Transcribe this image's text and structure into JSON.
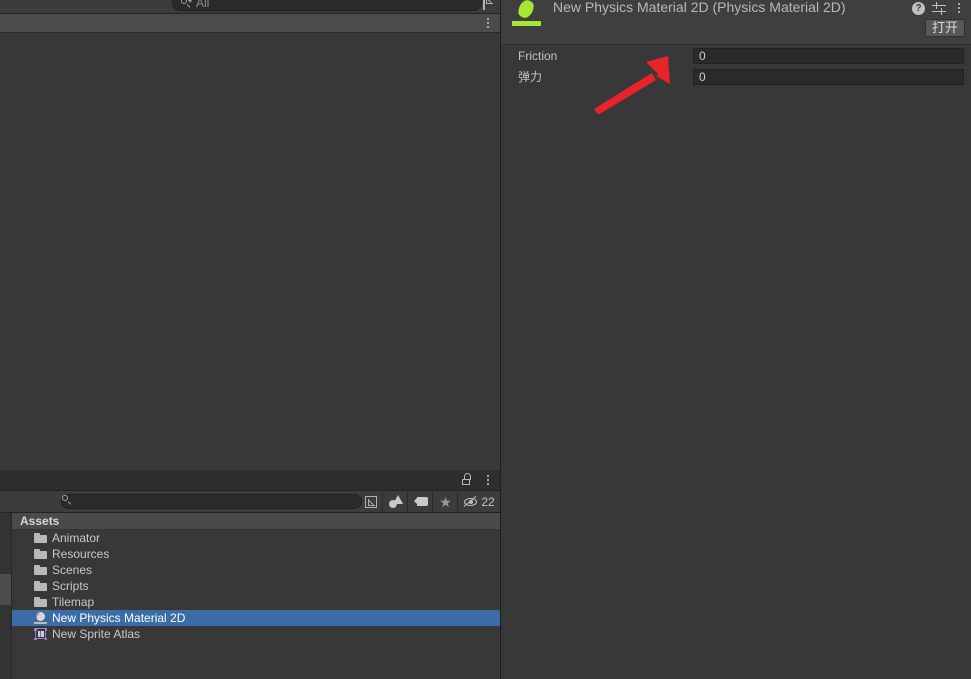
{
  "window": {
    "background_color": "#383838",
    "accent_selection_color": "#3a6da8",
    "asset_icon_green": "#a6e635",
    "annotation_color": "#e8232a"
  },
  "top_bar": {
    "search_placeholder": "All",
    "search_icon": "search-icon",
    "expand_icon": "expand-search-icon",
    "overflow_icon": "kebab-menu-icon"
  },
  "project_panel": {
    "lock_icon": "lock-icon",
    "overflow_icon": "kebab-menu-icon",
    "search_value": "",
    "search_icon": "search-icon",
    "expand_icon": "expand-search-icon",
    "filters": [
      {
        "name": "type-filter",
        "icon": "object-type-icon"
      },
      {
        "name": "label-filter",
        "icon": "tag-icon"
      },
      {
        "name": "favorites-filter",
        "icon": "star-icon",
        "glyph": "★"
      },
      {
        "name": "hidden-filter",
        "icon": "eye-off-icon",
        "count": "22"
      }
    ],
    "breadcrumb": "Assets",
    "items": [
      {
        "label": "Animator",
        "icon": "folder-icon",
        "selected": false
      },
      {
        "label": "Resources",
        "icon": "folder-icon",
        "selected": false
      },
      {
        "label": "Scenes",
        "icon": "folder-icon",
        "selected": false
      },
      {
        "label": "Scripts",
        "icon": "folder-icon",
        "selected": false
      },
      {
        "label": "Tilemap",
        "icon": "folder-icon",
        "selected": false
      },
      {
        "label": "New Physics Material 2D",
        "icon": "physics-material-icon",
        "selected": true
      },
      {
        "label": "New Sprite Atlas",
        "icon": "sprite-atlas-icon",
        "selected": false
      }
    ]
  },
  "inspector": {
    "title": "New Physics Material 2D (Physics Material 2D)",
    "asset_icon": "physics-material-2d-icon",
    "help_icon": "help-icon",
    "help_glyph": "?",
    "preset_icon": "preset-settings-icon",
    "overflow_icon": "kebab-menu-icon",
    "open_button_label": "打开",
    "properties": [
      {
        "label": "Friction",
        "value": "0"
      },
      {
        "label": "弹力",
        "value": "0"
      }
    ]
  }
}
